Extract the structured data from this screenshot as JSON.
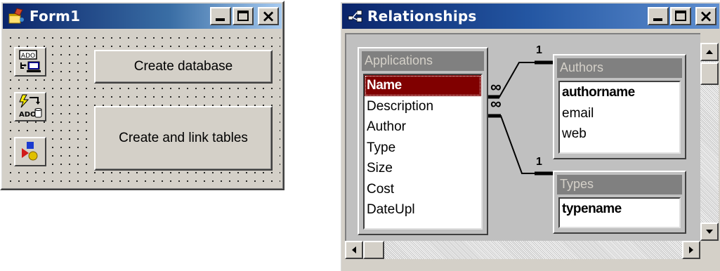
{
  "form1": {
    "title": "Form1",
    "title_icon": "vb-form-icon",
    "toolbox_icons": [
      "ado-data-control-icon",
      "ado-link-icon",
      "shapes-icon"
    ],
    "create_database_label": "Create database",
    "create_link_tables_label": "Create and link tables",
    "ado_label": "ADO"
  },
  "relationships": {
    "title": "Relationships",
    "title_icon": "relationships-icon",
    "tables": {
      "applications": {
        "title": "Applications",
        "fields": [
          "Name",
          "Description",
          "Author",
          "Type",
          "Size",
          "Cost",
          "DateUpl"
        ],
        "selected_field": "Name"
      },
      "authors": {
        "title": "Authors",
        "fields": [
          "authorname",
          "email",
          "web"
        ],
        "key_field": "authorname"
      },
      "types": {
        "title": "Types",
        "fields": [
          "typename"
        ],
        "key_field": "typename"
      }
    },
    "relations": [
      {
        "one_side": "Authors",
        "many_side": "Applications",
        "one_label": "1",
        "many_label": "∞"
      },
      {
        "one_side": "Types",
        "many_side": "Applications",
        "one_label": "1",
        "many_label": "∞"
      }
    ]
  },
  "colors": {
    "titlebar_active_start": "#0a246a",
    "titlebar_active_end": "#a6caf0",
    "selection_bg": "#800000",
    "window_face": "#d4d0c8"
  }
}
